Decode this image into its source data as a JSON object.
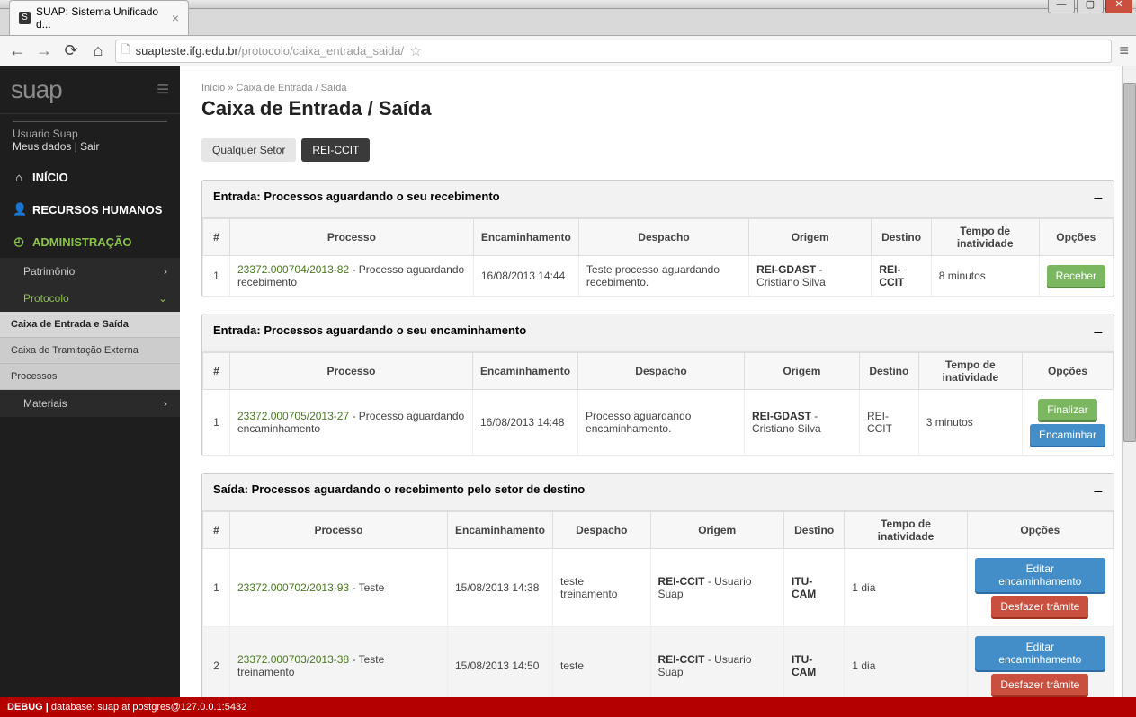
{
  "browser": {
    "tab_title": "SUAP: Sistema Unificado d...",
    "url_host": "suapteste.ifg.edu.br",
    "url_path": "/protocolo/caixa_entrada_saida/"
  },
  "sidebar": {
    "logo": "suap",
    "user_name": "Usuario Suap",
    "link_meus_dados": "Meus dados",
    "link_sair": "Sair",
    "nav_inicio": "INÍCIO",
    "nav_rh": "RECURSOS HUMANOS",
    "nav_admin": "ADMINISTRAÇÃO",
    "sub_patrimonio": "Patrimônio",
    "sub_protocolo": "Protocolo",
    "sub2_caixa": "Caixa de Entrada e Saída",
    "sub2_tramite": "Caixa de Tramitação Externa",
    "sub2_processos": "Processos",
    "sub_materiais": "Materiais"
  },
  "page": {
    "breadcrumb_home": "Início",
    "breadcrumb_sep": " » ",
    "breadcrumb_current": "Caixa de Entrada / Saída",
    "title": "Caixa de Entrada / Saída",
    "filter_all": "Qualquer Setor",
    "filter_sel": "REI-CCIT"
  },
  "panels": {
    "entrada_recebimento": {
      "title": "Entrada: Processos aguardando o seu recebimento",
      "cols": {
        "num": "#",
        "proc": "Processo",
        "enc": "Encaminhamento",
        "desp": "Despacho",
        "orig": "Origem",
        "dest": "Destino",
        "tempo": "Tempo de inatividade",
        "op": "Opções"
      },
      "rows": [
        {
          "n": "1",
          "link": "23372.000704/2013-82",
          "desc": " - Processo aguardando recebimento",
          "enc": "16/08/2013 14:44",
          "desp": "Teste processo aguardando recebimento.",
          "orig_b": "REI-GDAST",
          "orig_t": " - Cristiano Silva",
          "dest": "REI-CCIT",
          "tempo": "8 minutos",
          "btn_receber": "Receber"
        }
      ]
    },
    "entrada_encaminhamento": {
      "title": "Entrada: Processos aguardando o seu encaminhamento",
      "cols": {
        "num": "#",
        "proc": "Processo",
        "enc": "Encaminhamento",
        "desp": "Despacho",
        "orig": "Origem",
        "dest": "Destino",
        "tempo": "Tempo de inatividade",
        "op": "Opções"
      },
      "rows": [
        {
          "n": "1",
          "link": "23372.000705/2013-27",
          "desc": " - Processo aguardando encaminhamento",
          "enc": "16/08/2013 14:48",
          "desp": "Processo aguardando encaminhamento.",
          "orig_b": "REI-GDAST",
          "orig_t": " - Cristiano Silva",
          "dest": "REI-CCIT",
          "tempo": "3 minutos",
          "btn_finalizar": "Finalizar",
          "btn_encaminhar": "Encaminhar"
        }
      ]
    },
    "saida": {
      "title": "Saída: Processos aguardando o recebimento pelo setor de destino",
      "cols": {
        "num": "#",
        "proc": "Processo",
        "enc": "Encaminhamento",
        "desp": "Despacho",
        "orig": "Origem",
        "dest": "Destino",
        "tempo": "Tempo de inatividade",
        "op": "Opções"
      },
      "rows": [
        {
          "n": "1",
          "link": "23372.000702/2013-93",
          "desc": " - Teste",
          "enc": "15/08/2013 14:38",
          "desp": "teste treinamento",
          "orig_b": "REI-CCIT",
          "orig_t": " - Usuario Suap",
          "dest": "ITU-CAM",
          "tempo": "1 dia",
          "btn_editar": "Editar encaminhamento",
          "btn_desfazer": "Desfazer trâmite"
        },
        {
          "n": "2",
          "link": "23372.000703/2013-38",
          "desc": " - Teste treinamento",
          "enc": "15/08/2013 14:50",
          "desp": "teste",
          "orig_b": "REI-CCIT",
          "orig_t": " - Usuario Suap",
          "dest": "ITU-CAM",
          "tempo": "1 dia",
          "btn_editar": "Editar encaminhamento",
          "btn_desfazer": "Desfazer trâmite"
        }
      ]
    }
  },
  "debug": "DEBUG | database: suap at postgres@127.0.0.1:5432"
}
